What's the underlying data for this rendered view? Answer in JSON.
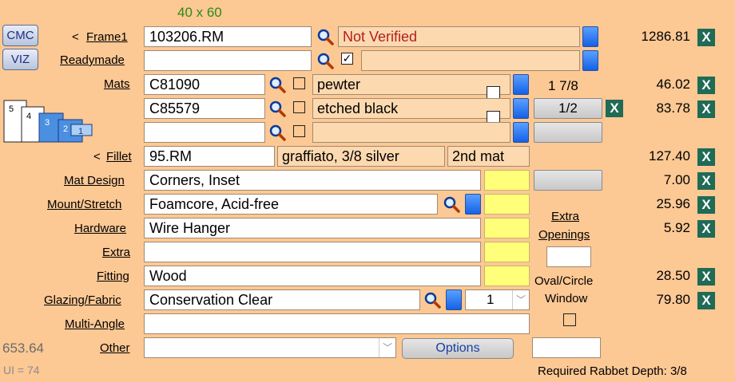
{
  "size": "40 x 60",
  "buttons": {
    "cmc": "CMC",
    "viz": "VIZ",
    "options": "Options"
  },
  "frame": {
    "prefix": "<",
    "label": "Frame1",
    "code": "103206.RM",
    "status": "Not Verified",
    "price": "1286.81"
  },
  "readymade": {
    "label": "Readymade",
    "code": "",
    "desc": ""
  },
  "mats": {
    "label": "Mats",
    "rows": [
      {
        "code": "C81090",
        "name": "pewter",
        "price": "46.02"
      },
      {
        "code": "C85579",
        "name": "etched black",
        "price": "83.78"
      },
      {
        "code": "",
        "name": "",
        "price": ""
      }
    ],
    "width1": "1 7/8",
    "reveal": "1/2",
    "stack_numbers": [
      "5",
      "4",
      "3",
      "2",
      "1"
    ]
  },
  "fillet": {
    "prefix": "<",
    "label": "Fillet",
    "code": "95.RM",
    "desc": "graffiato, 3/8 silver",
    "position": "2nd mat",
    "price": "127.40"
  },
  "mat_design": {
    "label": "Mat Design",
    "value": "Corners, Inset",
    "price": "7.00"
  },
  "mount": {
    "label": "Mount/Stretch",
    "value": "Foamcore, Acid-free",
    "price": "25.96"
  },
  "hardware": {
    "label": "Hardware",
    "value": "Wire Hanger",
    "price": "5.92"
  },
  "extra": {
    "label": "Extra",
    "value": ""
  },
  "fitting": {
    "label": "Fitting",
    "value": "Wood",
    "price": "28.50"
  },
  "glazing": {
    "label": "Glazing/Fabric",
    "value": "Conservation Clear",
    "qty": "1",
    "price": "79.80"
  },
  "multi_angle": {
    "label": "Multi-Angle",
    "value": ""
  },
  "other": {
    "label": "Other",
    "value": ""
  },
  "extra_openings": {
    "line1": "Extra",
    "line2": "Openings",
    "value": ""
  },
  "oval": {
    "line1": "Oval/Circle",
    "line2": "Window"
  },
  "total": "653.64",
  "ui": "UI = 74",
  "rabbet": "Required Rabbet Depth: 3/8",
  "x_label": "X"
}
